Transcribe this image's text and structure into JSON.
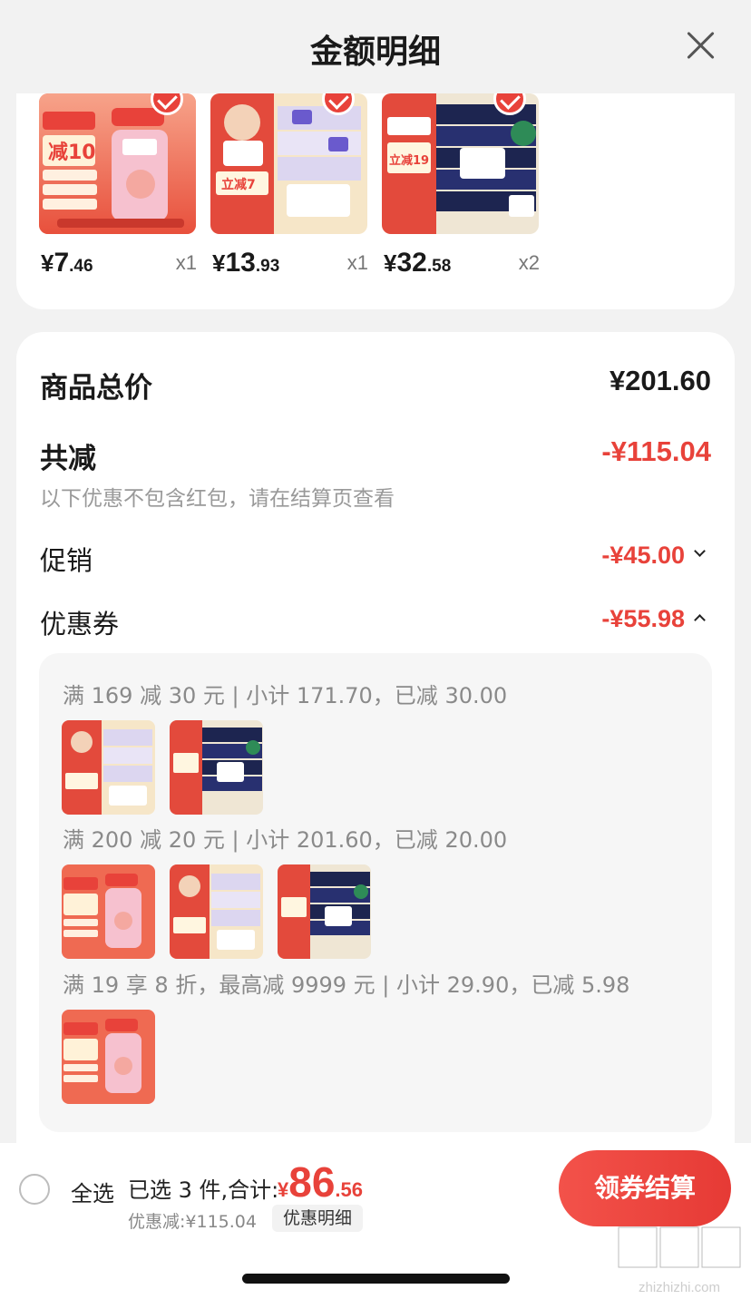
{
  "header": {
    "title": "金额明细"
  },
  "products": [
    {
      "price_yen": "¥",
      "price_int": "7",
      "price_dec": ".46",
      "qty": "x1",
      "image": "liby-dish-soap"
    },
    {
      "price_yen": "¥",
      "price_int": "13",
      "price_dec": ".93",
      "qty": "x1",
      "image": "tissue-pack-white"
    },
    {
      "price_yen": "¥",
      "price_int": "32",
      "price_dec": ".58",
      "qty": "x2",
      "image": "tissue-pack-pino"
    }
  ],
  "summary": {
    "total_label": "商品总价",
    "total_value": "¥201.60",
    "reduce_label": "共减",
    "reduce_value": "-¥115.04",
    "reduce_note": "以下优惠不包含红包，请在结算页查看",
    "promo_label": "促销",
    "promo_value": "-¥45.00",
    "coupon_label": "优惠券",
    "coupon_value": "-¥55.98"
  },
  "coupons": [
    {
      "text": "满 169 减 30 元 | 小计 171.70，已减 30.00"
    },
    {
      "text": "满 200 减 20 元 | 小计 201.60，已减 20.00"
    },
    {
      "text": "满 19 享 8 折，最高减 9999 元 | 小计 29.90，已减 5.98"
    }
  ],
  "bottom": {
    "select_all": "全选",
    "selected_info": "已选 3 件,合计:",
    "total_yen": "¥",
    "total_int": "86",
    "total_dec": ".56",
    "discount_line": "优惠减:¥115.04",
    "detail_chip": "优惠明细",
    "checkout": "领券结算"
  },
  "watermark": {
    "url": "zhizhizhi.com"
  },
  "colors": {
    "accent": "#e8423a",
    "background": "#f2f2f2"
  }
}
